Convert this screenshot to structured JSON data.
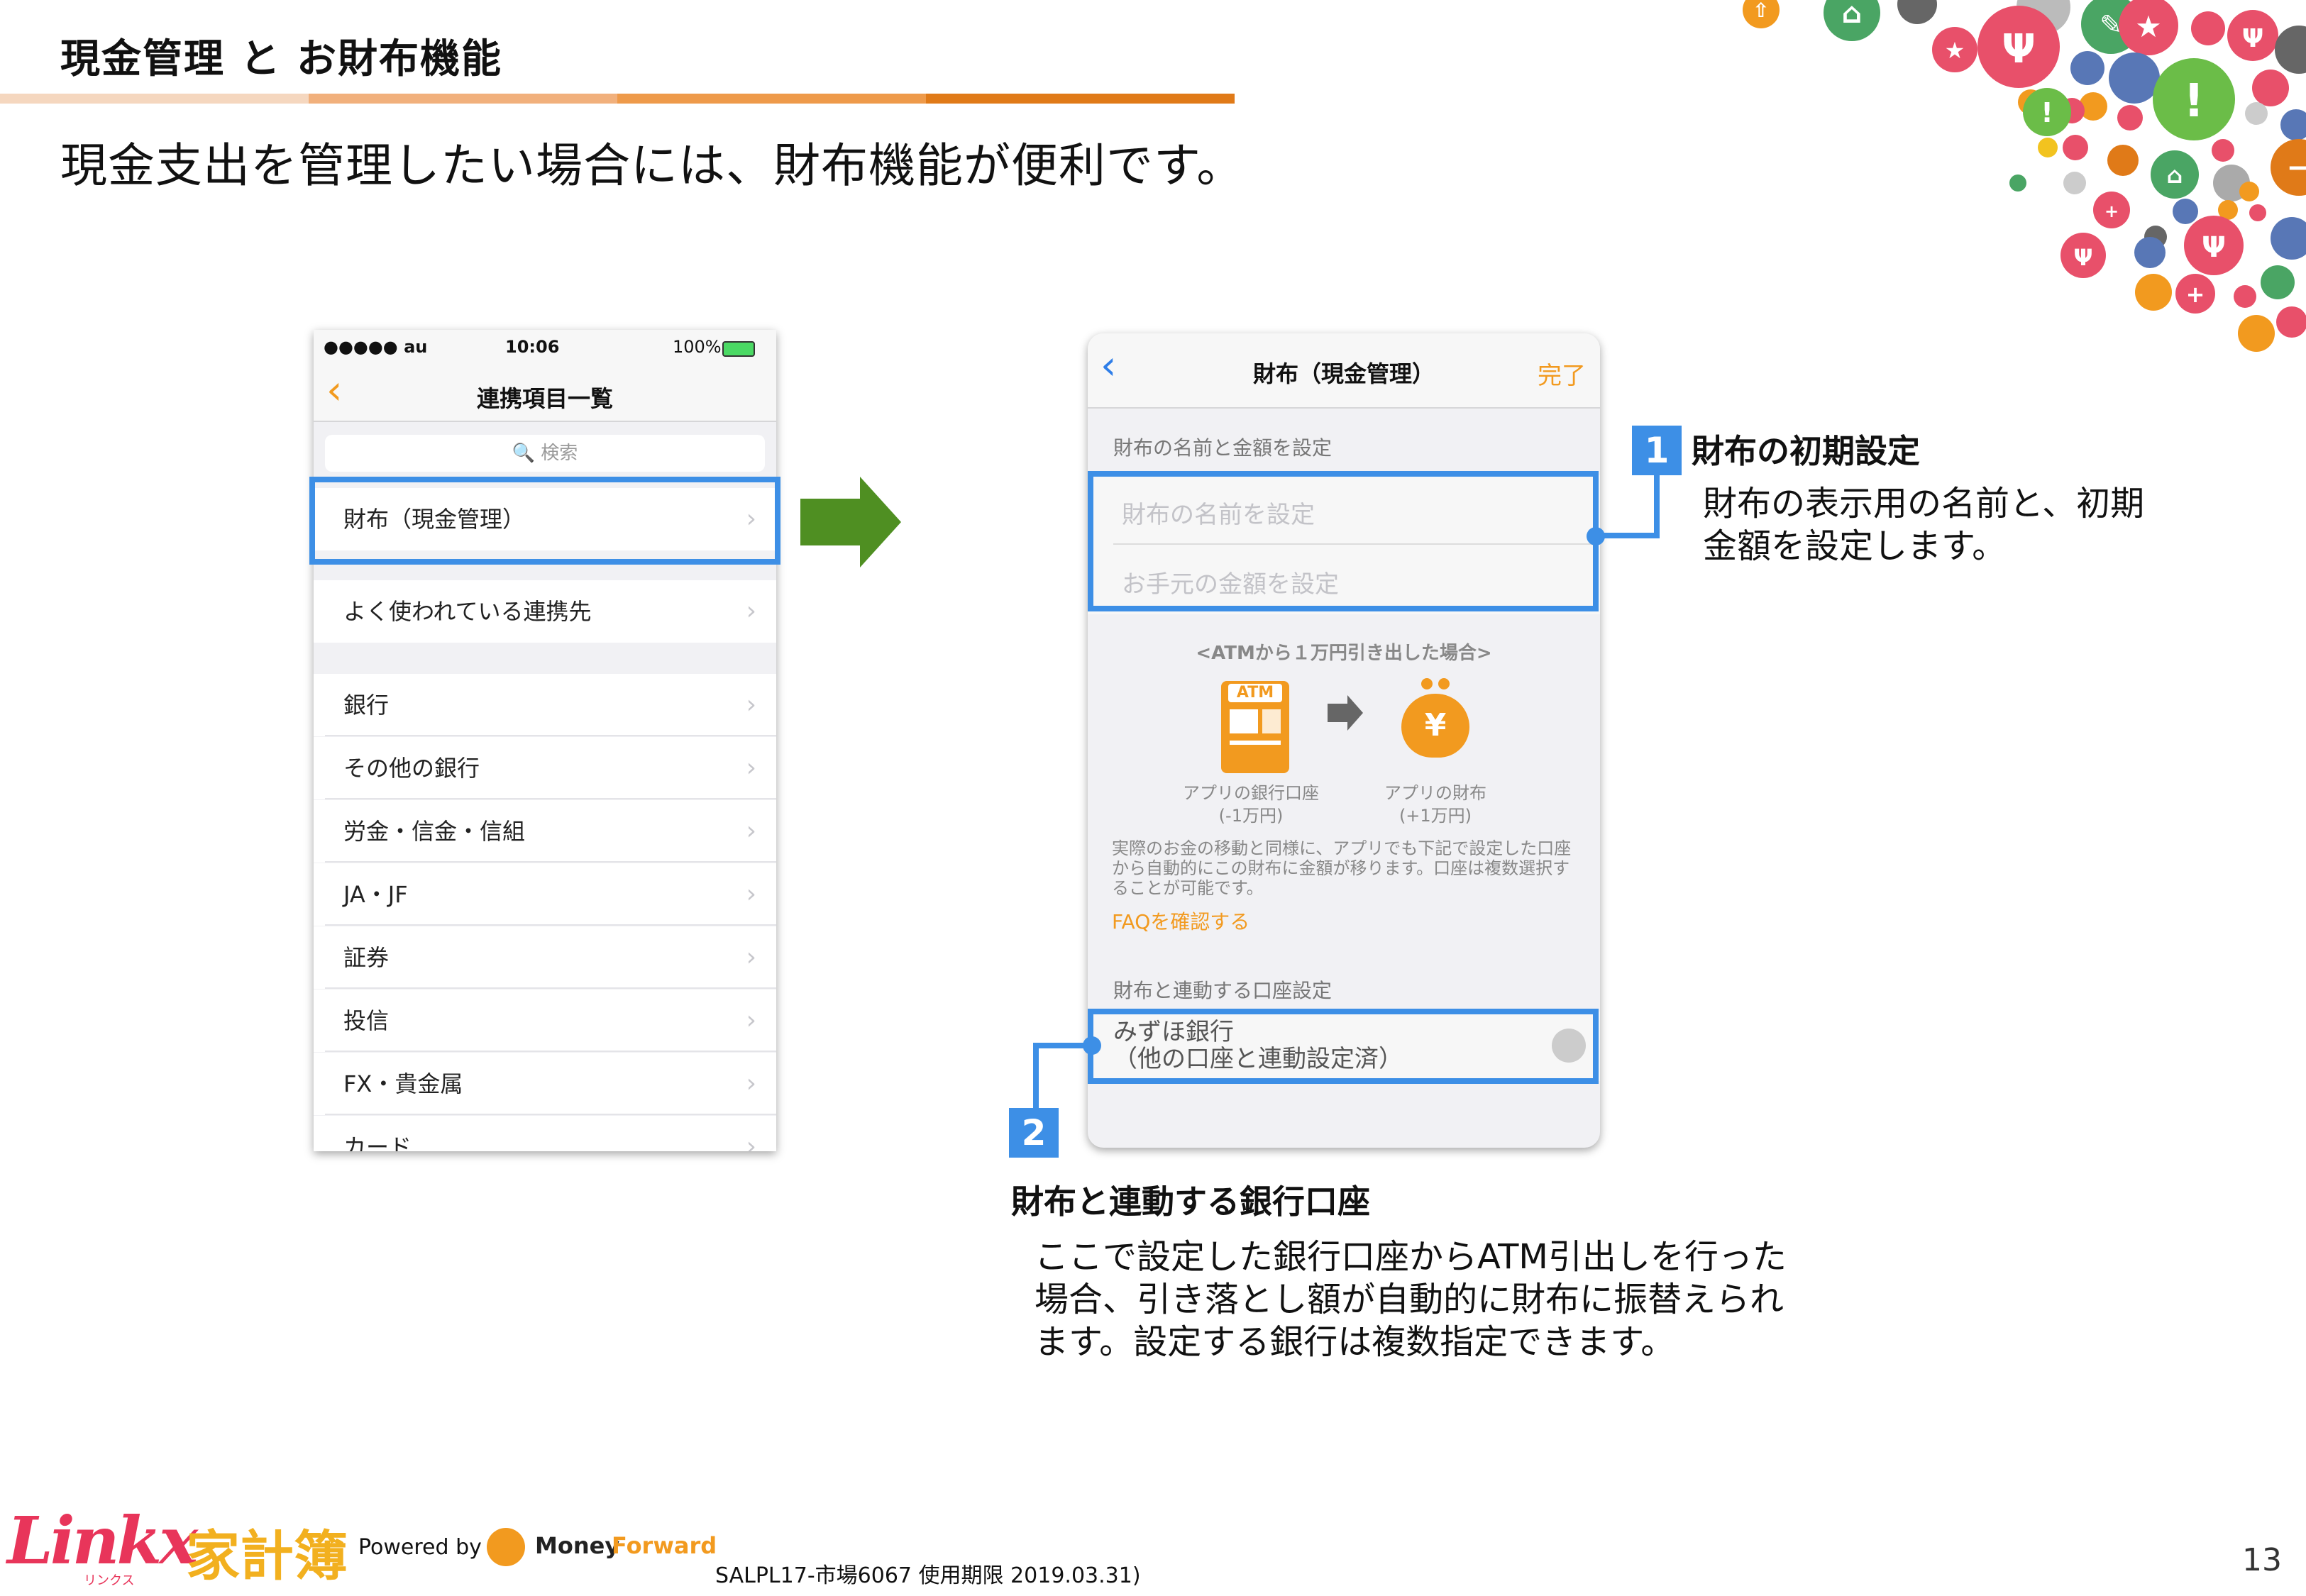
{
  "header": {
    "title": "現金管理 と お財布機能",
    "subtitle": "現金支出を管理したい場合には、財布機能が便利です。",
    "bar_colors": [
      "#f5d7bf",
      "#f1b07c",
      "#ee9a4a",
      "#e07a18"
    ]
  },
  "phone1": {
    "status": {
      "carrier": "●●●●● au",
      "time": "10:06",
      "battery": "100%"
    },
    "nav_title": "連携項目一覧",
    "search_placeholder": "🔍 検索",
    "rows": [
      {
        "label": "財布（現金管理）"
      },
      {
        "label": "よく使われている連携先"
      },
      {
        "label": "銀行"
      },
      {
        "label": "その他の銀行"
      },
      {
        "label": "労金・信金・信組"
      },
      {
        "label": "JA・JF"
      },
      {
        "label": "証券"
      },
      {
        "label": "投信"
      },
      {
        "label": "FX・貴金属"
      },
      {
        "label": "カード"
      }
    ],
    "chevron": "›"
  },
  "phone2": {
    "nav_title": "財布（現金管理）",
    "done": "完了",
    "section1": "財布の名前と金額を設定",
    "name_placeholder": "財布の名前を設定",
    "amount_placeholder": "お手元の金額を設定",
    "atm_caption": "<ATMから１万円引き出した場合>",
    "atm_label": "ATM",
    "bank_account": "アプリの銀行口座",
    "bank_delta": "(-1万円)",
    "wallet": "アプリの財布",
    "wallet_delta": "(+1万円)",
    "wallet_symbol": "¥",
    "description": "実際のお金の移動と同様に、アプリでも下記で設定した口座から自動的にこの財布に金額が移ります。口座は複数選択することが可能です。",
    "faq": "FAQを確認する",
    "section2": "財布と連動する口座設定",
    "bank_line1": "みずほ銀行",
    "bank_line2": "（他の口座と連動設定済）",
    "accent": "#f29a1f"
  },
  "callout1": {
    "number": "1",
    "title": "財布の初期設定",
    "text_line1": "財布の表示用の名前と、初期",
    "text_line2": "金額を設定します。"
  },
  "callout2": {
    "number": "2",
    "title": "財布と連動する銀行口座",
    "text_line1": "ここで設定した銀行口座からATM引出しを行った",
    "text_line2": "場合、引き落とし額が自動的に財布に振替えられ",
    "text_line3": "ます。設定する銀行は複数指定できます。"
  },
  "footer": {
    "logo_text": "Linkx",
    "logo_sub": "リンクス",
    "kakeibo": "家計簿",
    "powered_by": "Powered by",
    "mf_money": "Money",
    "mf_forward": "Forward",
    "code": "SALPL17-市場6067 使用期限 2019.03.31)",
    "page_number": "13"
  },
  "colors": {
    "highlight": "#3d8fe6",
    "arrow": "#4f8f22",
    "orange": "#f29a1f"
  }
}
